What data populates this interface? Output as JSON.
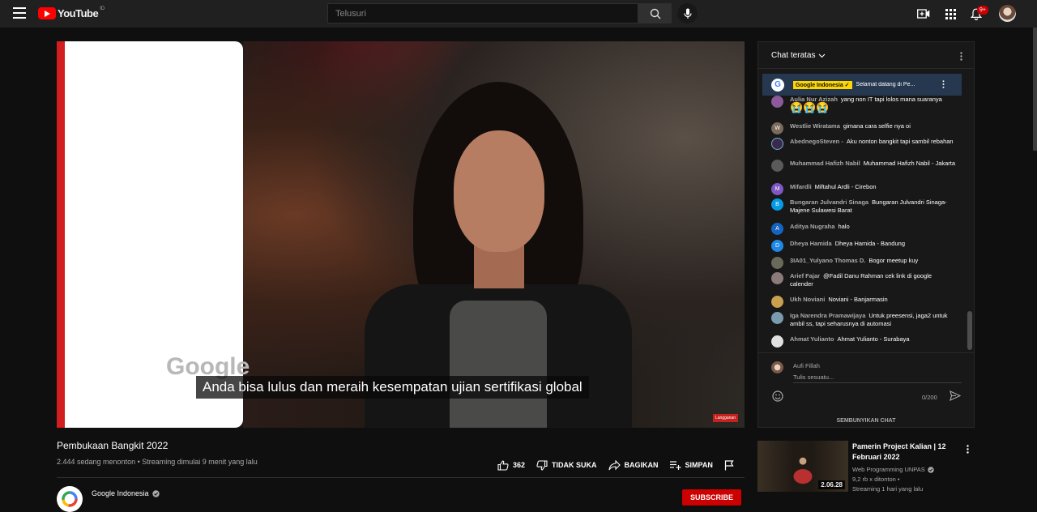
{
  "header": {
    "logo_text": "YouTube",
    "country_code": "ID",
    "search_placeholder": "Telusuri",
    "notification_count": "9+"
  },
  "video": {
    "caption": "Anda bisa lulus dan meraih kesempatan ujian sertifikasi global",
    "shirt_text": "Google",
    "watermark": "Langganan",
    "title": "Pembukaan Bangkit 2022",
    "meta": "2.444 sedang menonton • Streaming dimulai 9 menit yang lalu"
  },
  "actions": {
    "like_count": "362",
    "dislike": "TIDAK SUKA",
    "share": "BAGIKAN",
    "save": "SIMPAN"
  },
  "channel": {
    "name": "Google Indonesia",
    "subscribe": "SUBSCRIBE"
  },
  "chat": {
    "title": "Chat teratas",
    "pinned": {
      "author": "Google Indonesia",
      "message": "Selamat datang di Pe..."
    },
    "messages": [
      {
        "author": "Aulia Nur Azizah",
        "text": "yang non IT tapi lolos mana suaranya",
        "emoji": "😭😭😭",
        "initial": "",
        "color": "#8a5a9a"
      },
      {
        "author": "Westlie Wiratama",
        "text": "gimana cara selfie nya oi",
        "emoji": "",
        "initial": "W",
        "color": "#7a6a5a"
      },
      {
        "author": "AbednegoSteven -",
        "text": "Aku nonton bangkit tapi sambil rebahan",
        "emoji": "",
        "initial": "",
        "color": "#3a2a4a"
      },
      {
        "author": "Muhammad Hafizh Nabil",
        "text": "Muhammad Hafizh Nabil - Jakarta",
        "emoji": "",
        "initial": "",
        "color": "#5a5a5a"
      },
      {
        "author": "Mifardli",
        "text": "Miftahul Ardli - Cirebon",
        "emoji": "",
        "initial": "M",
        "color": "#7e57c2"
      },
      {
        "author": "Bungaran Julvandri Sinaga",
        "text": "Bungaran Julvandri Sinaga-Majene Sulawesi Barat",
        "emoji": "",
        "initial": "B",
        "color": "#039be5"
      },
      {
        "author": "Aditya Nugraha",
        "text": "halo",
        "emoji": "",
        "initial": "A",
        "color": "#1565c0"
      },
      {
        "author": "Dheya Hamida",
        "text": "Dheya Hamida - Bandung",
        "emoji": "",
        "initial": "D",
        "color": "#1e88e5"
      },
      {
        "author": "3IA01_Yulyano Thomas D.",
        "text": "Bogor meetup kuy",
        "emoji": "",
        "initial": "",
        "color": "#6a6a5a"
      },
      {
        "author": "Arief Fajar",
        "text": "@Fadil Danu Rahman cek link di google calender",
        "emoji": "",
        "initial": "",
        "color": "#8a7a7a"
      },
      {
        "author": "Ukh Noviani",
        "text": "Noviani - Banjarmasin",
        "emoji": "",
        "initial": "",
        "color": "#c8a050"
      },
      {
        "author": "Iga Narendra Pramawijaya",
        "text": "Untuk preesensi, jaga2 untuk ambil ss, tapi seharusnya di automasi",
        "emoji": "",
        "initial": "",
        "color": "#7a9ab0"
      },
      {
        "author": "Ahmat Yulianto",
        "text": "Ahmat Yulianto - Surabaya",
        "emoji": "",
        "initial": "",
        "color": "#e0e0e0"
      }
    ],
    "input": {
      "author": "Aufi Fillah",
      "placeholder": "Tulis sesuatu...",
      "counter": "0/200"
    },
    "hide_label": "SEMBUNYIKAN CHAT"
  },
  "recommendation": {
    "title": "Pamerin Project Kalian | 12 Februari 2022",
    "channel": "Web Programming UNPAS",
    "views": "9,2 rb x ditonton •",
    "time": "Streaming 1 hari yang lalu",
    "duration": "2.06.28"
  }
}
